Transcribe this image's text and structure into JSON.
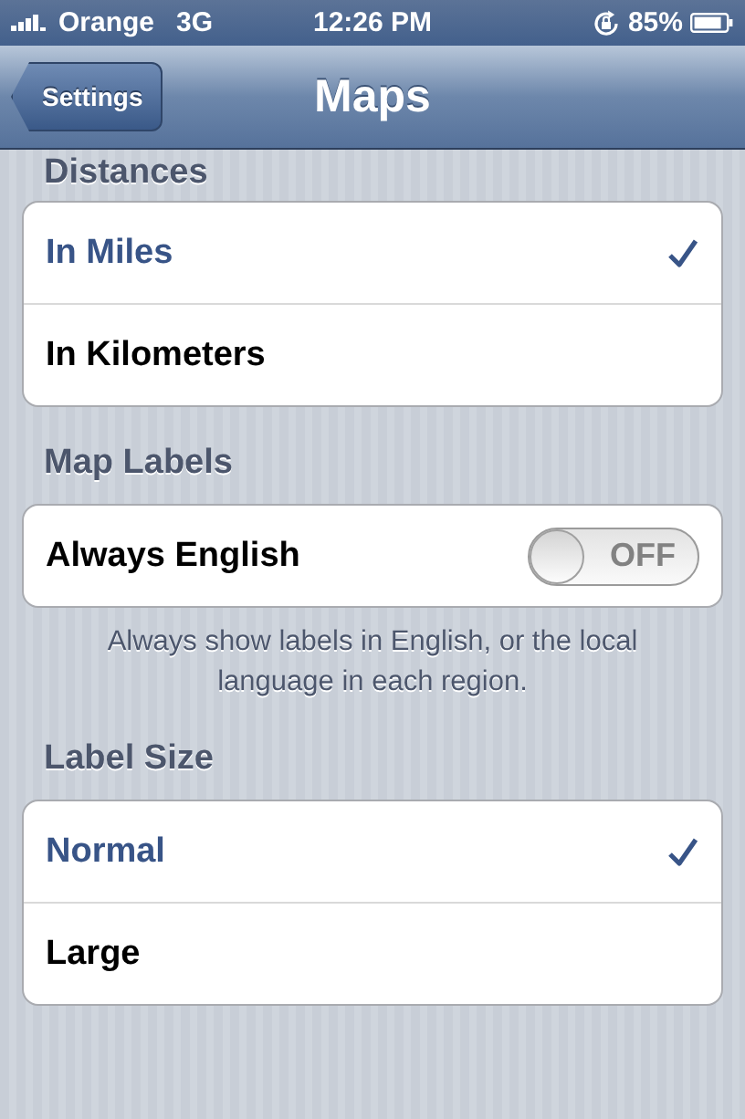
{
  "status_bar": {
    "carrier": "Orange",
    "network": "3G",
    "time": "12:26 PM",
    "battery": "85%"
  },
  "nav_bar": {
    "back": "Settings",
    "title": "Maps"
  },
  "sections": [
    {
      "header": "Distances",
      "rows": [
        {
          "kind": "check",
          "label": "In Miles",
          "selected": true
        },
        {
          "kind": "check",
          "label": "In Kilometers",
          "selected": false
        }
      ]
    },
    {
      "header": "Map Labels",
      "rows": [
        {
          "kind": "switch",
          "label": "Always English",
          "on": false,
          "switch_text": "OFF"
        }
      ],
      "footer": "Always show labels in English, or the local language in each region."
    },
    {
      "header": "Label Size",
      "rows": [
        {
          "kind": "check",
          "label": "Normal",
          "selected": true
        },
        {
          "kind": "check",
          "label": "Large",
          "selected": false
        }
      ]
    }
  ]
}
